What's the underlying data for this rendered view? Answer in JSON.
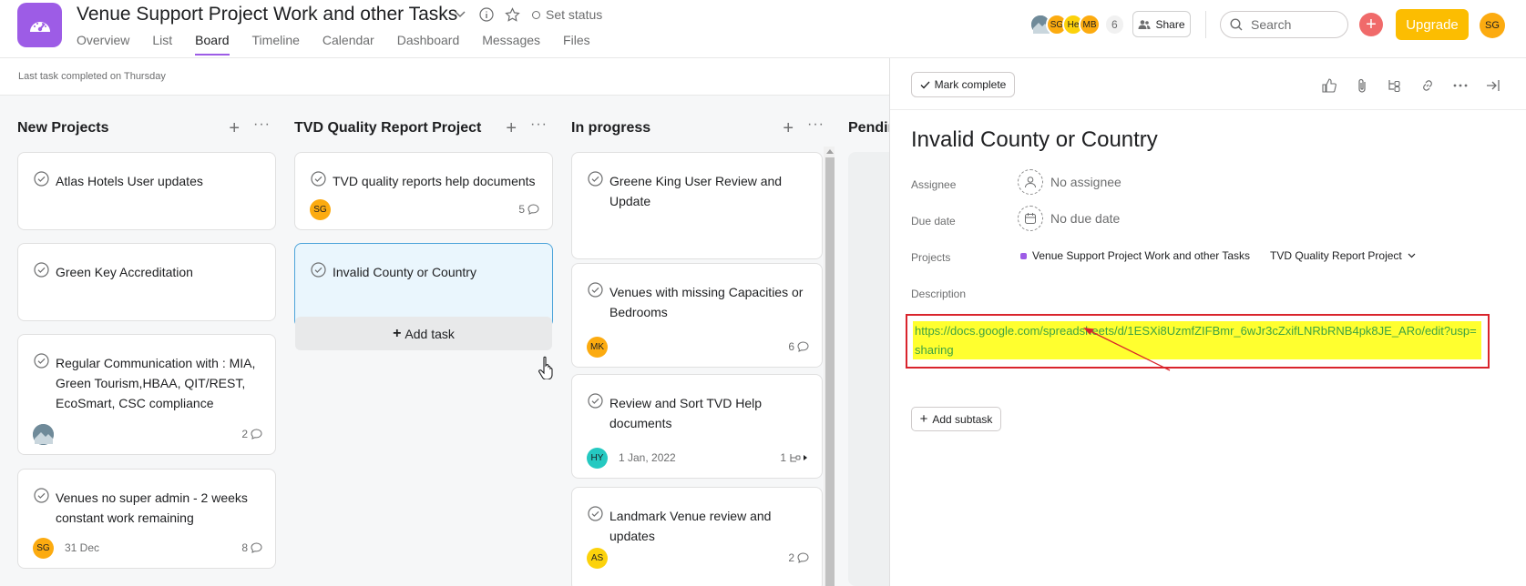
{
  "header": {
    "project_title": "Venue Support Project Work and other Tasks",
    "set_status": "Set status",
    "tabs": [
      {
        "label": "Overview"
      },
      {
        "label": "List"
      },
      {
        "label": "Board"
      },
      {
        "label": "Timeline"
      },
      {
        "label": "Calendar"
      },
      {
        "label": "Dashboard"
      },
      {
        "label": "Messages"
      },
      {
        "label": "Files"
      }
    ],
    "active_tab": "Board",
    "members": [
      {
        "initials": "",
        "color": "#5a7a8c"
      },
      {
        "initials": "SG",
        "color": "#fcab10"
      },
      {
        "initials": "He",
        "color": "#fcd20b"
      },
      {
        "initials": "MB",
        "color": "#fcab10"
      }
    ],
    "member_count": "6",
    "share_label": "Share",
    "search_placeholder": "Search",
    "upgrade_label": "Upgrade",
    "user_initials": "SG",
    "accent_color": "#9d5ce6"
  },
  "subbar": {
    "status_text": "Last task completed on Thursday"
  },
  "columns": [
    {
      "title": "New Projects",
      "cards": [
        {
          "name": "Atlas Hotels User updates"
        },
        {
          "name": "Green Key Accreditation"
        },
        {
          "name": "Regular Communication with : MIA, Green Tourism,HBAA, QIT/REST, EcoSmart, CSC compliance",
          "avatar": "",
          "comments": "2"
        },
        {
          "name": "Venues no super admin - 2 weeks constant work remaining",
          "avatar": "SG",
          "date": "31 Dec",
          "comments": "8"
        }
      ]
    },
    {
      "title": "TVD Quality Report Project",
      "cards": [
        {
          "name": "TVD quality reports help documents",
          "avatar": "SG",
          "comments": "5"
        },
        {
          "name": "Invalid County or Country",
          "selected": true
        }
      ],
      "add_task": "Add task"
    },
    {
      "title": "In progress",
      "cards": [
        {
          "name": "Greene King User Review and Update"
        },
        {
          "name": "Venues with missing Capacities or Bedrooms",
          "avatar": "MK",
          "comments": "6"
        },
        {
          "name": "Review and Sort TVD Help documents",
          "avatar": "HY",
          "date": "1 Jan, 2022",
          "subtasks": "1"
        },
        {
          "name": "Landmark Venue review and updates",
          "avatar": "AS",
          "comments": "2"
        }
      ]
    },
    {
      "title": "Pendin"
    }
  ],
  "task_panel": {
    "mark_complete": "Mark complete",
    "title": "Invalid County or Country",
    "assignee_label": "Assignee",
    "assignee_value": "No assignee",
    "due_label": "Due date",
    "due_value": "No due date",
    "projects_label": "Projects",
    "project_1": "Venue Support Project Work and other Tasks",
    "project_2": "TVD Quality Report Project",
    "description_label": "Description",
    "description_link": "https://docs.google.com/spreadsheets/d/1ESXi8UzmfZIFBmr_6wJr3cZxifLNRbRNB4pk8JE_ARo/edit?usp=sharing",
    "add_subtask": "Add subtask",
    "highlight_color": "#ffff2f",
    "annotation_color": "#d9242c"
  }
}
